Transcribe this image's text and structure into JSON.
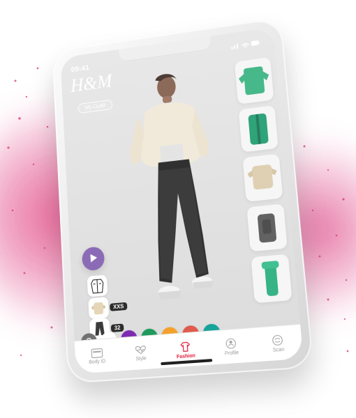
{
  "status": {
    "time": "09:41"
  },
  "brand": {
    "logo": "H&M"
  },
  "screen": {
    "top_pill": "My Outfit"
  },
  "outfit": {
    "size_top": "XXS",
    "size_bottom": "32"
  },
  "colors": {
    "splash_pink": "#e03a7a",
    "play_button": "#8b6bb6",
    "active_nav": "#e21d3b",
    "swatches": [
      "#707070",
      "#ffffff",
      "#7d2bb3",
      "#1f9a5c",
      "#f4a12b",
      "#e05a4d",
      "#16a39a"
    ]
  },
  "navigation": [
    {
      "label": "Body ID",
      "icon": "card-icon"
    },
    {
      "label": "Style",
      "icon": "heart-pulse-icon"
    },
    {
      "label": "Fashion",
      "icon": "shirt-icon"
    },
    {
      "label": "Profile",
      "icon": "profile-icon"
    },
    {
      "label": "Scan",
      "icon": "scan-icon"
    }
  ]
}
